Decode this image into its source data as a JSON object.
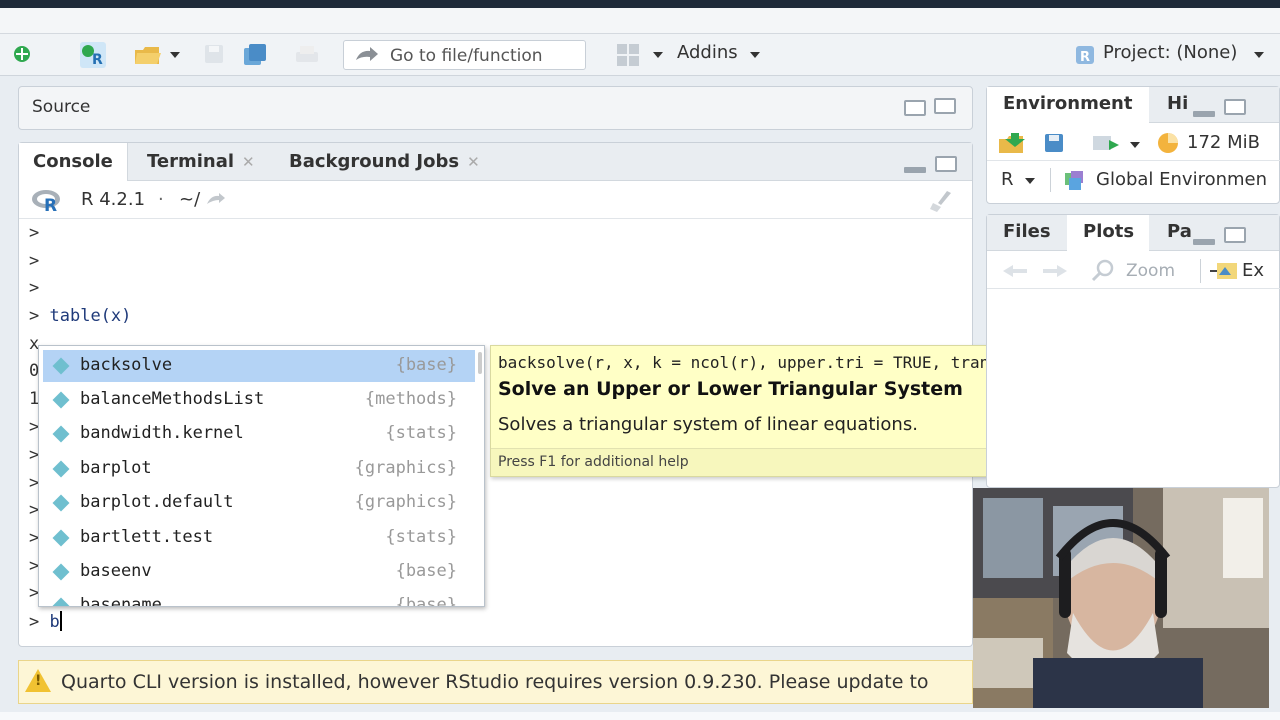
{
  "toolbar": {
    "goto_placeholder": "Go to file/function",
    "addins_label": "Addins",
    "project_label": "Project: (None)"
  },
  "source": {
    "title": "Source"
  },
  "console": {
    "tabs": [
      {
        "label": "Console"
      },
      {
        "label": "Terminal"
      },
      {
        "label": "Background Jobs"
      }
    ],
    "r_version": "R 4.2.1",
    "path": "~/",
    "lines": [
      {
        "prompt": ">",
        "text": ""
      },
      {
        "prompt": ">",
        "text": ""
      },
      {
        "prompt": ">",
        "text": ""
      },
      {
        "prompt": ">",
        "text": "table(x)"
      },
      {
        "prompt": "x",
        "text": ""
      },
      {
        "prompt": "0",
        "text": ""
      },
      {
        "prompt": "1",
        "text": ""
      },
      {
        "prompt": ">",
        "text": ""
      },
      {
        "prompt": ">",
        "text": ""
      },
      {
        "prompt": ">",
        "text": ""
      },
      {
        "prompt": ">",
        "text": ""
      },
      {
        "prompt": ">",
        "text": ""
      },
      {
        "prompt": ">",
        "text": ""
      },
      {
        "prompt": ">",
        "text": ""
      }
    ],
    "current_input": {
      "prompt": ">",
      "text": "b"
    }
  },
  "autocomplete": {
    "items": [
      {
        "name": "backsolve",
        "pkg": "{base}"
      },
      {
        "name": "balanceMethodsList",
        "pkg": "{methods}"
      },
      {
        "name": "bandwidth.kernel",
        "pkg": "{stats}"
      },
      {
        "name": "barplot",
        "pkg": "{graphics}"
      },
      {
        "name": "barplot.default",
        "pkg": "{graphics}"
      },
      {
        "name": "bartlett.test",
        "pkg": "{stats}"
      },
      {
        "name": "baseenv",
        "pkg": "{base}"
      },
      {
        "name": "basename",
        "pkg": "{base}"
      }
    ],
    "selected_index": 0
  },
  "help_popup": {
    "signature": "backsolve(r, x, k = ncol(r), upper.tri = TRUE, transpose = FALSE)",
    "title": "Solve an Upper or Lower Triangular System",
    "description": "Solves a triangular system of linear equations.",
    "footer": "Press F1 for additional help"
  },
  "environment": {
    "tabs": [
      {
        "label": "Environment"
      },
      {
        "label": "Hi"
      }
    ],
    "memory": "172 MiB",
    "language": "R",
    "scope": "Global Environmen"
  },
  "files": {
    "tabs": [
      {
        "label": "Files"
      },
      {
        "label": "Plots"
      },
      {
        "label": "Pa"
      }
    ],
    "zoom_label": "Zoom",
    "export_label": "Ex"
  },
  "banner": {
    "message": "Quarto CLI version is installed, however RStudio requires version 0.9.230. Please update to"
  },
  "colors": {
    "selection": "#b4d3f5",
    "help_bg": "#ffffc6",
    "banner_bg": "#fdf6d6",
    "code_blue": "#1f3a7a"
  }
}
